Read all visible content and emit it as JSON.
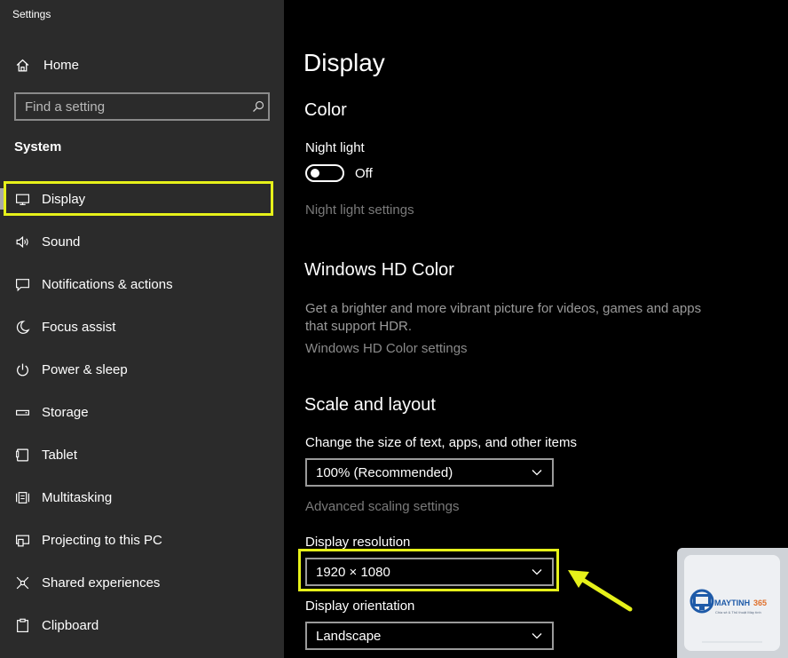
{
  "app_title": "Settings",
  "sidebar": {
    "home_label": "Home",
    "search_placeholder": "Find a setting",
    "section_label": "System",
    "items": [
      {
        "label": "Display",
        "icon": "monitor-icon"
      },
      {
        "label": "Sound",
        "icon": "speaker-icon"
      },
      {
        "label": "Notifications & actions",
        "icon": "notification-icon"
      },
      {
        "label": "Focus assist",
        "icon": "moon-icon"
      },
      {
        "label": "Power & sleep",
        "icon": "power-icon"
      },
      {
        "label": "Storage",
        "icon": "storage-icon"
      },
      {
        "label": "Tablet",
        "icon": "tablet-icon"
      },
      {
        "label": "Multitasking",
        "icon": "multitasking-icon"
      },
      {
        "label": "Projecting to this PC",
        "icon": "projecting-icon"
      },
      {
        "label": "Shared experiences",
        "icon": "shared-icon"
      },
      {
        "label": "Clipboard",
        "icon": "clipboard-icon"
      }
    ],
    "selected": "Display"
  },
  "main": {
    "title": "Display",
    "color_heading": "Color",
    "night_light_label": "Night light",
    "night_light_state": "Off",
    "night_light_settings": "Night light settings",
    "hdr_heading": "Windows HD Color",
    "hdr_desc": "Get a brighter and more vibrant picture for videos, games and apps that support HDR.",
    "hdr_link": "Windows HD Color settings",
    "scale_heading": "Scale and layout",
    "scale_label": "Change the size of text, apps, and other items",
    "scale_value": "100% (Recommended)",
    "advanced_scaling": "Advanced scaling settings",
    "resolution_label": "Display resolution",
    "resolution_value": "1920 × 1080",
    "orientation_label": "Display orientation",
    "orientation_value": "Landscape"
  },
  "watermark": {
    "brand": "MAYTINH365",
    "tagline": "Chia sẻ & Thủ thuật Máy tính"
  },
  "colors": {
    "highlight": "#e6f11a",
    "sidebar_bg": "#2b2b2b",
    "content_bg": "#000000"
  }
}
